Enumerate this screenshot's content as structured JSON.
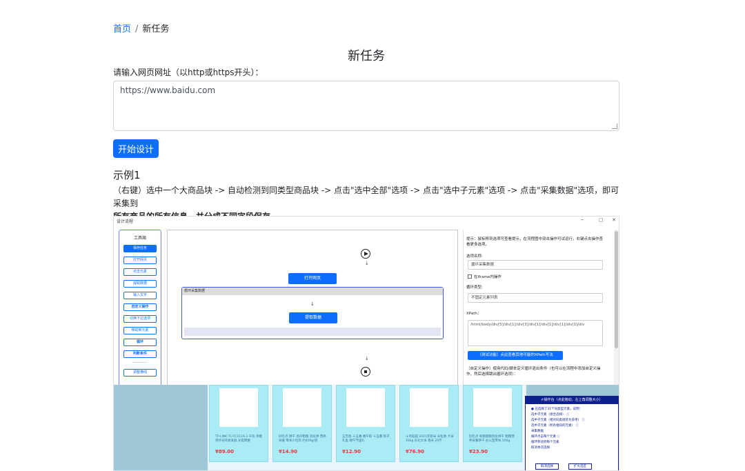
{
  "breadcrumb": {
    "home": "首页",
    "separator": "/",
    "current": "新任务"
  },
  "page_title": "新任务",
  "url_label": "请输入网页网址（以http或https开头）：",
  "url_value": "https://www.baidu.com",
  "start_button": "开始设计",
  "example": {
    "title": "示例1",
    "description_pre": "（右键）选中一个大商品块 -> 自动检测到同类型商品块 -> 点击\"选中全部\"选项 -> 点击\"选中子元素\"选项 -> 点击\"采集数据\"选项，即可采集到",
    "description_bold": "所有商品的所有信息，并分成不同字段保存。"
  },
  "screenshot": {
    "window_title": "设计流程",
    "toolbox": {
      "header": "工具箱",
      "buttons": [
        "保存任务",
        "打开网页",
        "点击元素",
        "提取数据",
        "输入文字",
        "自定义操作",
        "切换下拉选项",
        "移动到元素",
        "循环",
        "判断条件",
        "------------",
        "调整横线"
      ]
    },
    "canvas": {
      "open_page": "打开网页",
      "loop_label": "循环采集数据",
      "extract": "提取数据",
      "arrow": "↓"
    },
    "panel": {
      "tip": "提示：鼠标移到选项可查看提示，在流程图中双击操作可试运行，右键点击操作查看更多选项。",
      "name_label": "选项名称:",
      "name_value": "循环采集数据",
      "iframe_label": "在iframe内操作",
      "loop_type_label": "循环类型:",
      "loop_type_value": "不固定元素列表",
      "xpath_label": "XPath：",
      "xpath_value": "/html/body/div[5]/div[1]/div[3]/div[1]/div[1]/div[1]/div[1]/div",
      "xpath_button": "（测试功能）点此查看其他可能的XPath写法",
      "custom_note": "（自定义操作）使用代码/脚本定义循环退出条件（也可以在流程中添加自定义操作，然后选择跳出循环选项）："
    },
    "products": [
      {
        "name": "TP-LINK TL-FC311A-3 千兆 单模单纤光纤收发器 光电转换",
        "price": "¥89.00"
      },
      {
        "name": "好吃点 饼干 高纤粗粮 消化饼 营养早餐 零食小包装 约400g/袋",
        "price": "¥14.90"
      },
      {
        "name": "五芳斋 十五番 端午粽 十五番 粽子礼盒 端午节送礼",
        "price": "¥12.90"
      },
      {
        "name": "十月稻田 2021年新米 长粒香 大米 10kg 东北大米 香米 20斤",
        "price": "¥76.90"
      },
      {
        "name": "好吃点 杂粮粗粮消化饼干 粗粮营养早餐饼干 办公室零食 500g",
        "price": "¥23.90"
      }
    ],
    "float": {
      "header": "✍操作台（点此拖动，左上角调整大小）",
      "lines": [
        "● 已选择了31个同类型元素，说明：",
        "选中子元素（组合选择） ⓘ",
        "选中子元素（相对同类组装为多项） ⓘ",
        "选中子元素（所有相同的元素） ⓘ",
        "采集数据",
        "循环点击每个元素 ⓘ",
        "循环移动到每个元素",
        "取消本次选择"
      ],
      "btn_left": "取消选择",
      "btn_right": "扩大选区"
    }
  }
}
